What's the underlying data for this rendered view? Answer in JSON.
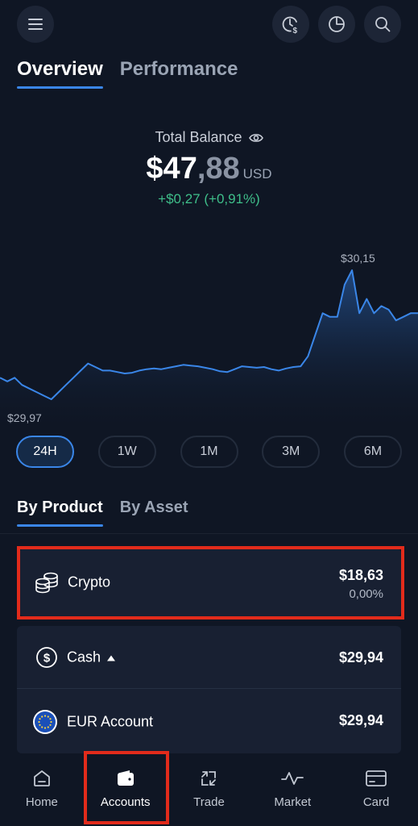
{
  "header": {
    "menu_icon": "menu-icon",
    "actions": [
      "clock-dollar-icon",
      "pie-chart-icon",
      "search-icon"
    ]
  },
  "top_tabs": [
    {
      "label": "Overview",
      "active": true
    },
    {
      "label": "Performance",
      "active": false
    }
  ],
  "balance": {
    "label": "Total Balance",
    "amount_int": "$47",
    "amount_dec": ",88",
    "currency": "USD",
    "change": "+$0,27 (+0,91%)"
  },
  "chart_data": {
    "type": "area",
    "x_range": "24H",
    "high_label": "$30,15",
    "low_label": "$29,97",
    "ylim": [
      29.97,
      30.15
    ],
    "values": [
      30.0,
      29.995,
      30.0,
      29.99,
      29.985,
      29.98,
      29.975,
      29.97,
      29.98,
      29.99,
      30.0,
      30.01,
      30.02,
      30.015,
      30.01,
      30.01,
      30.008,
      30.006,
      30.007,
      30.01,
      30.012,
      30.013,
      30.012,
      30.014,
      30.016,
      30.018,
      30.017,
      30.016,
      30.014,
      30.012,
      30.009,
      30.008,
      30.012,
      30.016,
      30.015,
      30.014,
      30.015,
      30.012,
      30.01,
      30.013,
      30.015,
      30.016,
      30.03,
      30.06,
      30.09,
      30.085,
      30.085,
      30.13,
      30.15,
      30.09,
      30.11,
      30.09,
      30.1,
      30.095,
      30.08,
      30.085,
      30.09,
      30.09
    ]
  },
  "ranges": [
    {
      "label": "24H",
      "active": true
    },
    {
      "label": "1W",
      "active": false
    },
    {
      "label": "1M",
      "active": false
    },
    {
      "label": "3M",
      "active": false
    },
    {
      "label": "6M",
      "active": false
    }
  ],
  "mid_tabs": [
    {
      "label": "By Product",
      "active": true
    },
    {
      "label": "By Asset",
      "active": false
    }
  ],
  "products": {
    "crypto": {
      "name": "Crypto",
      "amount": "$18,63",
      "change": "0,00%",
      "icon": "coins-icon"
    },
    "cash": {
      "name": "Cash",
      "amount": "$29,94",
      "icon": "dollar-circle-icon"
    },
    "eur": {
      "name": "EUR Account",
      "amount": "$29,94",
      "icon": "eu-flag-icon"
    }
  },
  "nav": [
    {
      "label": "Home",
      "icon": "home-icon",
      "active": false
    },
    {
      "label": "Accounts",
      "icon": "wallet-icon",
      "active": true
    },
    {
      "label": "Trade",
      "icon": "trade-arrows-icon",
      "active": false
    },
    {
      "label": "Market",
      "icon": "pulse-icon",
      "active": false
    },
    {
      "label": "Card",
      "icon": "card-icon",
      "active": false
    }
  ],
  "colors": {
    "background": "#0f1624",
    "accent": "#3a86e8",
    "positive": "#3fbf8a",
    "highlight": "#e22b1b",
    "card": "#182032"
  }
}
